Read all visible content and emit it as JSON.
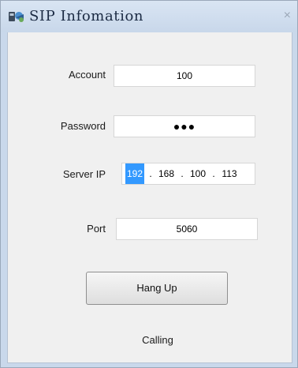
{
  "window": {
    "title": "SIP Infomation",
    "icon": "sip-app-icon",
    "close_glyph": "×"
  },
  "form": {
    "account_label": "Account",
    "account_value": "100",
    "password_label": "Password",
    "password_value": "●●●",
    "server_ip_label": "Server IP",
    "server_ip": [
      "192",
      "168",
      "100",
      "113"
    ],
    "server_ip_separator": ".",
    "port_label": "Port",
    "port_value": "5060"
  },
  "actions": {
    "hangup_label": "Hang Up"
  },
  "status": {
    "text": "Calling"
  },
  "colors": {
    "selection": "#3399ff",
    "titlebar": "#c9d8eb"
  }
}
